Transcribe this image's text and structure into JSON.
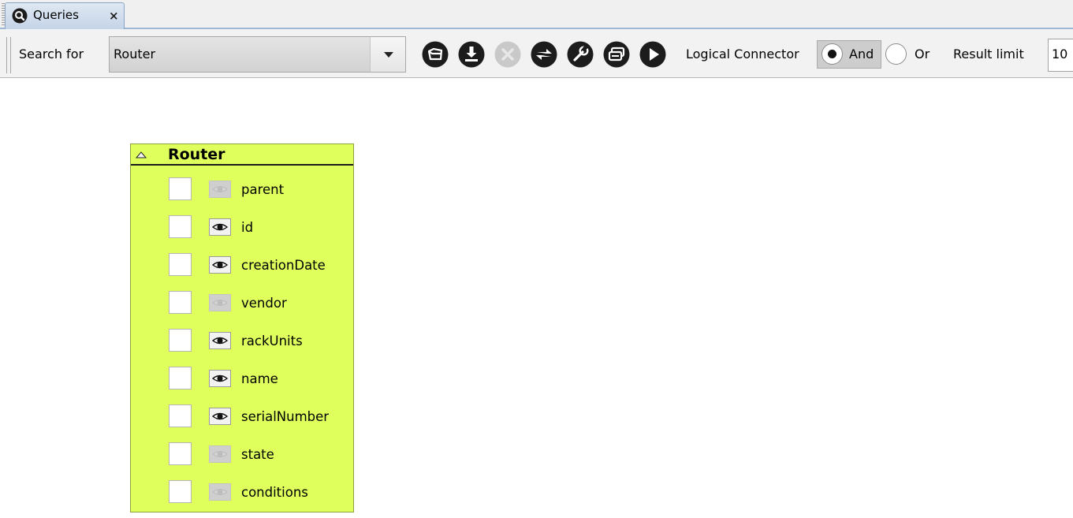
{
  "tab": {
    "label": "Queries",
    "close": "×",
    "icon": "search-icon"
  },
  "toolbar": {
    "search_label": "Search for",
    "search_value": "Router",
    "tools": [
      {
        "name": "open-query-button",
        "icon": "open-folder-icon",
        "enabled": true
      },
      {
        "name": "save-query-button",
        "icon": "download-icon",
        "enabled": true
      },
      {
        "name": "delete-query-button",
        "icon": "close-circle-icon",
        "enabled": false
      },
      {
        "name": "switch-view-button",
        "icon": "swap-icon",
        "enabled": true
      },
      {
        "name": "configure-button",
        "icon": "wrench-icon",
        "enabled": true
      },
      {
        "name": "organize-button",
        "icon": "layers-icon",
        "enabled": true
      },
      {
        "name": "execute-query-button",
        "icon": "play-icon",
        "enabled": true
      }
    ],
    "connector_label": "Logical Connector",
    "and_label": "And",
    "or_label": "Or",
    "and_selected": true,
    "limit_label": "Result limit",
    "limit_value": "10"
  },
  "node": {
    "title": "Router",
    "attributes": [
      {
        "label": "parent",
        "visible": false
      },
      {
        "label": "id",
        "visible": true
      },
      {
        "label": "creationDate",
        "visible": true
      },
      {
        "label": "vendor",
        "visible": false
      },
      {
        "label": "rackUnits",
        "visible": true
      },
      {
        "label": "name",
        "visible": true
      },
      {
        "label": "serialNumber",
        "visible": true
      },
      {
        "label": "state",
        "visible": false
      },
      {
        "label": "conditions",
        "visible": false
      }
    ]
  },
  "colors": {
    "node_bg": "#dfff5c",
    "icon_dark": "#1c1c1c",
    "icon_disabled": "#c7c7c7"
  }
}
